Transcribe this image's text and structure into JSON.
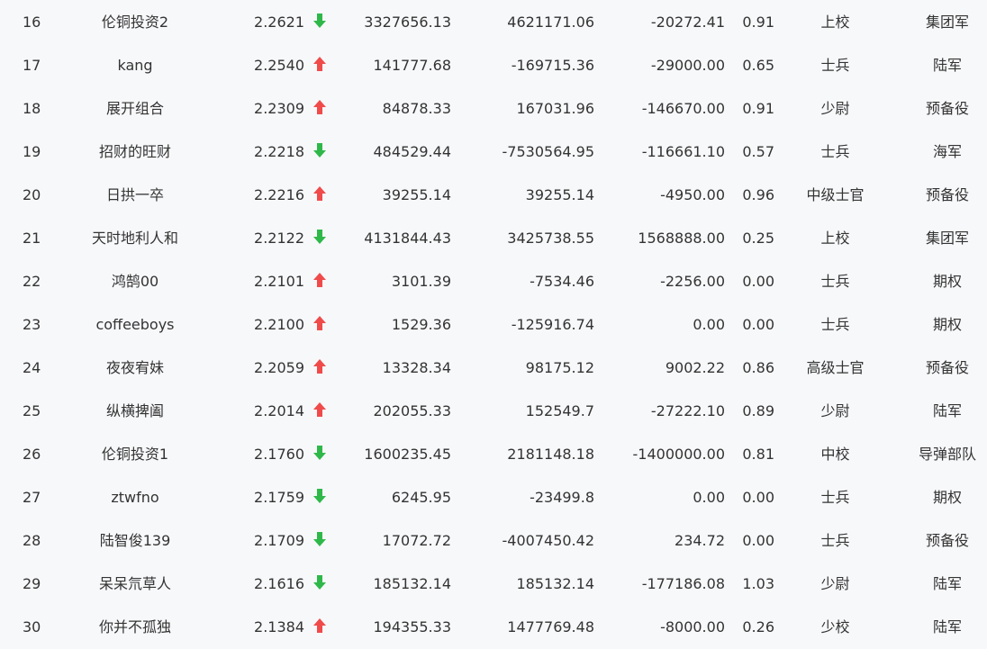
{
  "colors": {
    "up": "#f04b4b",
    "down": "#2fb84a",
    "text": "#333333",
    "background": "#f7f8fa"
  },
  "rows": [
    {
      "rank": "16",
      "name": "伦铜投资2",
      "nav": "2.2621",
      "trend": "down",
      "v1": "3327656.13",
      "v2": "4621171.06",
      "v3": "-20272.41",
      "ratio": "0.91",
      "title": "上校",
      "group": "集团军"
    },
    {
      "rank": "17",
      "name": "kang",
      "nav": "2.2540",
      "trend": "up",
      "v1": "141777.68",
      "v2": "-169715.36",
      "v3": "-29000.00",
      "ratio": "0.65",
      "title": "士兵",
      "group": "陆军"
    },
    {
      "rank": "18",
      "name": "展开组合",
      "nav": "2.2309",
      "trend": "up",
      "v1": "84878.33",
      "v2": "167031.96",
      "v3": "-146670.00",
      "ratio": "0.91",
      "title": "少尉",
      "group": "预备役"
    },
    {
      "rank": "19",
      "name": "招财的旺财",
      "nav": "2.2218",
      "trend": "down",
      "v1": "484529.44",
      "v2": "-7530564.95",
      "v3": "-116661.10",
      "ratio": "0.57",
      "title": "士兵",
      "group": "海军"
    },
    {
      "rank": "20",
      "name": "日拱一卒",
      "nav": "2.2216",
      "trend": "up",
      "v1": "39255.14",
      "v2": "39255.14",
      "v3": "-4950.00",
      "ratio": "0.96",
      "title": "中级士官",
      "group": "预备役"
    },
    {
      "rank": "21",
      "name": "天时地利人和",
      "nav": "2.2122",
      "trend": "down",
      "v1": "4131844.43",
      "v2": "3425738.55",
      "v3": "1568888.00",
      "ratio": "0.25",
      "title": "上校",
      "group": "集团军"
    },
    {
      "rank": "22",
      "name": "鸿鹄00",
      "nav": "2.2101",
      "trend": "up",
      "v1": "3101.39",
      "v2": "-7534.46",
      "v3": "-2256.00",
      "ratio": "0.00",
      "title": "士兵",
      "group": "期权"
    },
    {
      "rank": "23",
      "name": "coffeeboys",
      "nav": "2.2100",
      "trend": "up",
      "v1": "1529.36",
      "v2": "-125916.74",
      "v3": "0.00",
      "ratio": "0.00",
      "title": "士兵",
      "group": "期权"
    },
    {
      "rank": "24",
      "name": "夜夜宥妹",
      "nav": "2.2059",
      "trend": "up",
      "v1": "13328.34",
      "v2": "98175.12",
      "v3": "9002.22",
      "ratio": "0.86",
      "title": "高级士官",
      "group": "预备役"
    },
    {
      "rank": "25",
      "name": "纵横捭阖",
      "nav": "2.2014",
      "trend": "up",
      "v1": "202055.33",
      "v2": "152549.7",
      "v3": "-27222.10",
      "ratio": "0.89",
      "title": "少尉",
      "group": "陆军"
    },
    {
      "rank": "26",
      "name": "伦铜投资1",
      "nav": "2.1760",
      "trend": "down",
      "v1": "1600235.45",
      "v2": "2181148.18",
      "v3": "-1400000.00",
      "ratio": "0.81",
      "title": "中校",
      "group": "导弹部队"
    },
    {
      "rank": "27",
      "name": "ztwfno",
      "nav": "2.1759",
      "trend": "down",
      "v1": "6245.95",
      "v2": "-23499.8",
      "v3": "0.00",
      "ratio": "0.00",
      "title": "士兵",
      "group": "期权"
    },
    {
      "rank": "28",
      "name": "陆智俊139",
      "nav": "2.1709",
      "trend": "down",
      "v1": "17072.72",
      "v2": "-4007450.42",
      "v3": "234.72",
      "ratio": "0.00",
      "title": "士兵",
      "group": "预备役"
    },
    {
      "rank": "29",
      "name": "呆呆氘草人",
      "nav": "2.1616",
      "trend": "down",
      "v1": "185132.14",
      "v2": "185132.14",
      "v3": "-177186.08",
      "ratio": "1.03",
      "title": "少尉",
      "group": "陆军"
    },
    {
      "rank": "30",
      "name": "你并不孤独",
      "nav": "2.1384",
      "trend": "up",
      "v1": "194355.33",
      "v2": "1477769.48",
      "v3": "-8000.00",
      "ratio": "0.26",
      "title": "少校",
      "group": "陆军"
    }
  ]
}
